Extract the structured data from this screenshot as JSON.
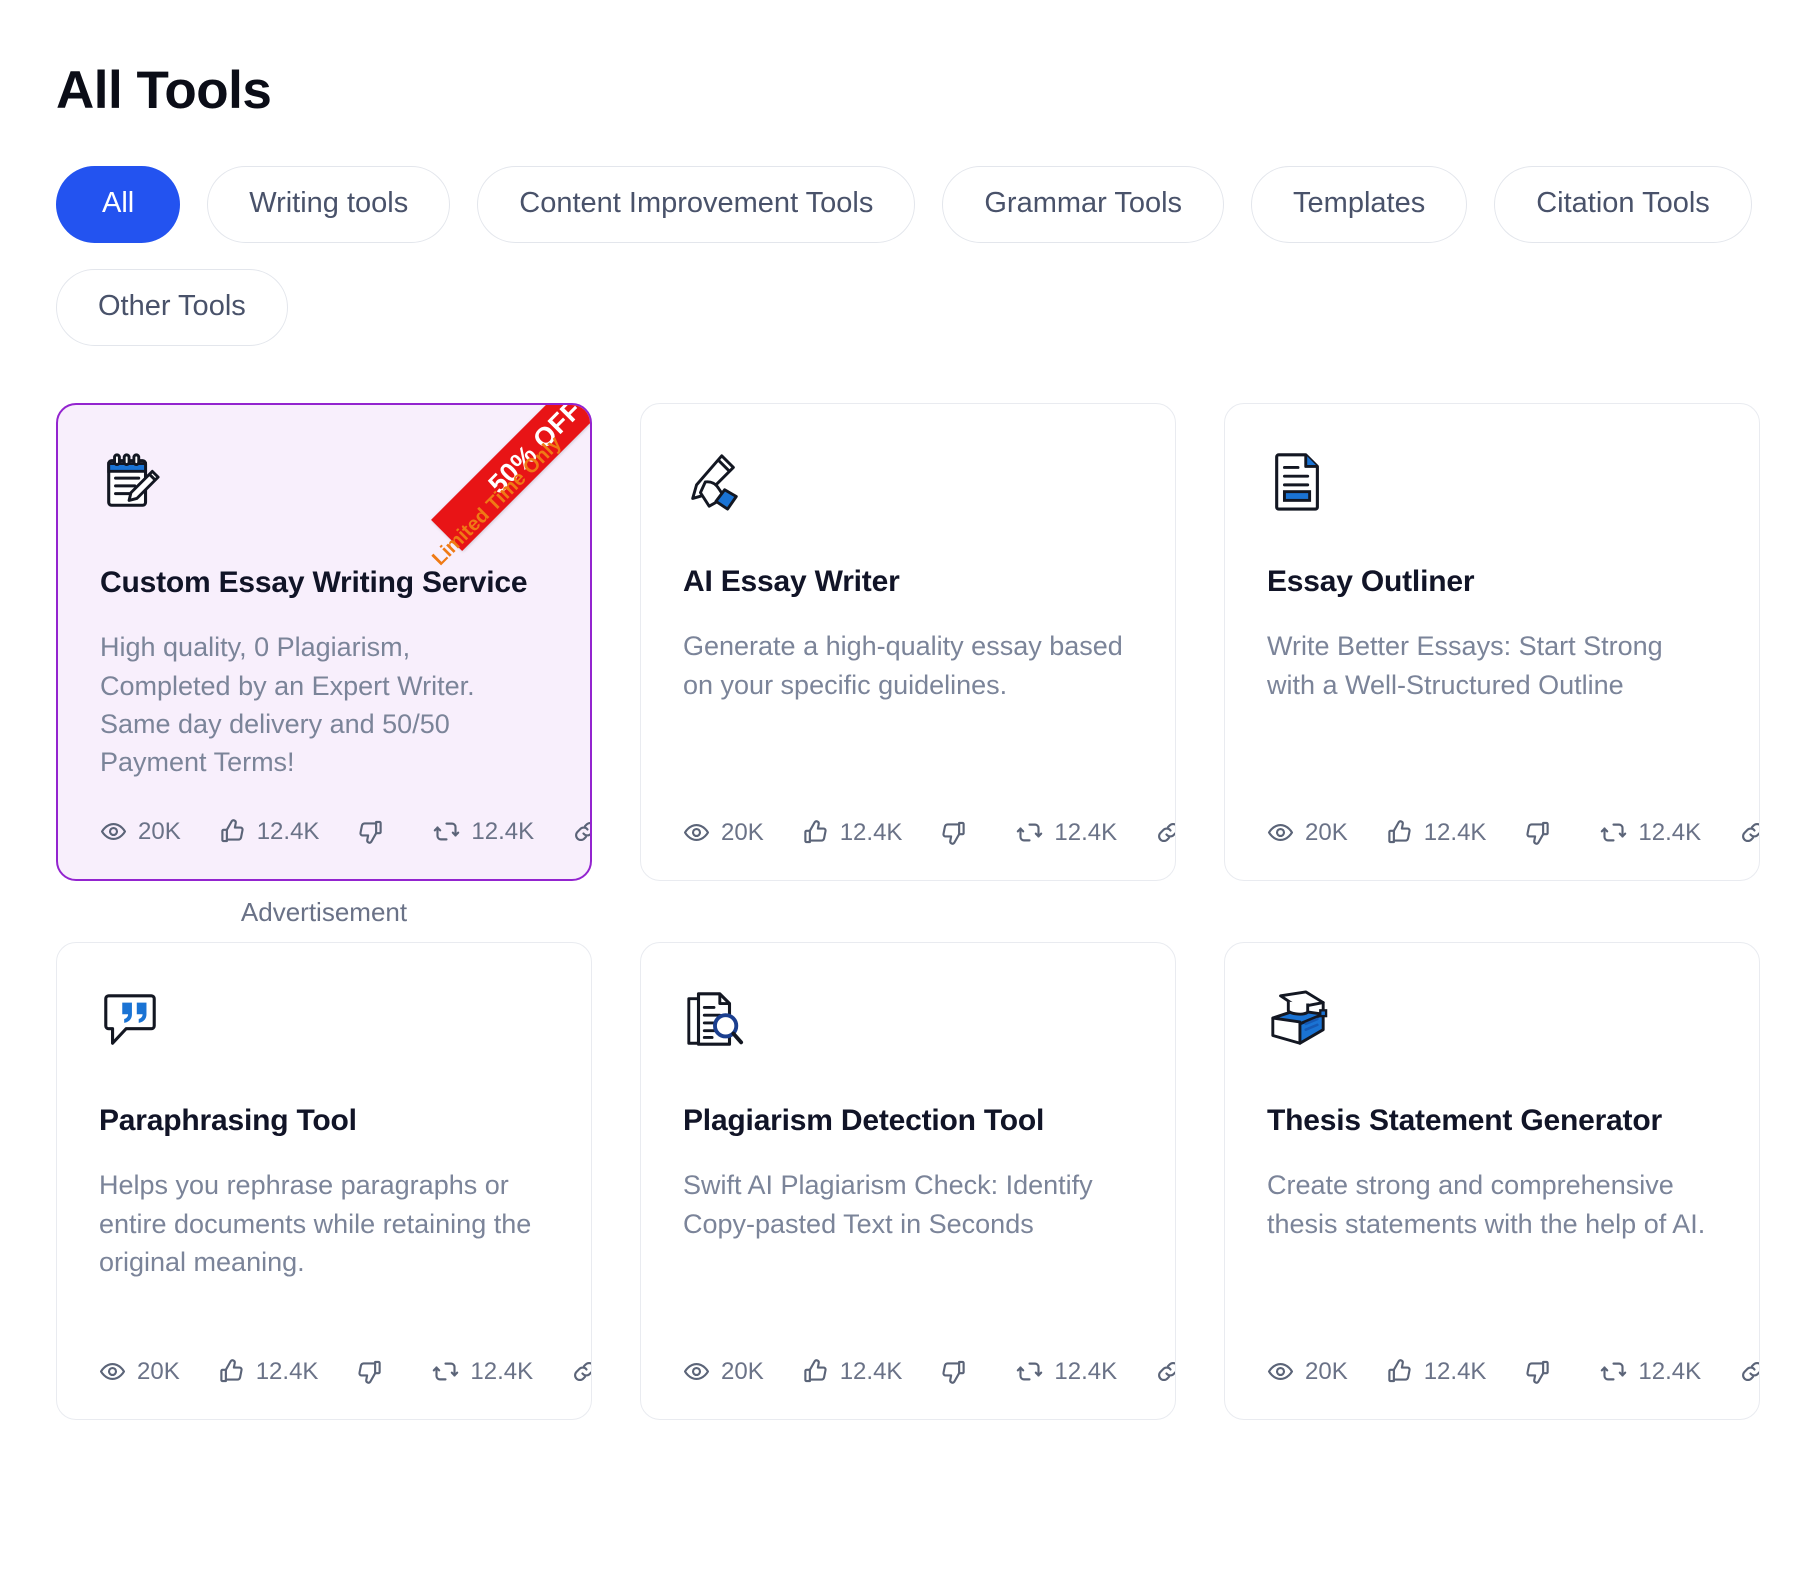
{
  "header": {
    "title": "All Tools"
  },
  "filters": [
    {
      "label": "All",
      "active": true
    },
    {
      "label": "Writing tools",
      "active": false
    },
    {
      "label": "Content Improvement Tools",
      "active": false
    },
    {
      "label": "Grammar Tools",
      "active": false
    },
    {
      "label": "Templates",
      "active": false
    },
    {
      "label": "Citation Tools",
      "active": false
    },
    {
      "label": "Other Tools",
      "active": false
    }
  ],
  "ribbon": {
    "main_label": "50% OFF",
    "sub_label": "Limited Time Only",
    "banner_color": "#e81416",
    "sub_color": "#ef7a15"
  },
  "ad_label": "Advertisement",
  "accent_colors": {
    "active_pill": "#2353f0",
    "promo_border": "#9324cf",
    "promo_background": "#f8effc",
    "icon_blue": "#1a73d4"
  },
  "stat_icons": [
    "eye-icon",
    "thumbs-up-icon",
    "thumbs-down-icon",
    "repost-icon",
    "link-icon"
  ],
  "cards": [
    {
      "icon": "notepad-pencil-icon",
      "title": "Custom Essay Writing Service",
      "description": "High quality, 0 Plagiarism, Completed by an Expert Writer. Same day delivery and 50/50 Payment Terms!",
      "promo": true,
      "stats": {
        "views": "20K",
        "likes": "12.4K",
        "dislikes": "",
        "reposts": "12.4K"
      }
    },
    {
      "icon": "hand-writing-pencil-icon",
      "title": "AI Essay Writer",
      "description": "Generate a high-quality essay based on your specific guidelines.",
      "promo": false,
      "stats": {
        "views": "20K",
        "likes": "12.4K",
        "dislikes": "",
        "reposts": "12.4K"
      }
    },
    {
      "icon": "document-outline-icon",
      "title": "Essay Outliner",
      "description": "Write Better Essays: Start Strong with a Well-Structured Outline",
      "promo": false,
      "stats": {
        "views": "20K",
        "likes": "12.4K",
        "dislikes": "",
        "reposts": "12.4K"
      }
    },
    {
      "icon": "quote-bubble-icon",
      "title": "Paraphrasing Tool",
      "description": "Helps you rephrase paragraphs or entire documents while retaining the original meaning.",
      "promo": false,
      "stats": {
        "views": "20K",
        "likes": "12.4K",
        "dislikes": "",
        "reposts": "12.4K"
      }
    },
    {
      "icon": "documents-magnifier-icon",
      "title": "Plagiarism Detection Tool",
      "description": "Swift AI Plagiarism Check: Identify Copy-pasted Text in Seconds",
      "promo": false,
      "stats": {
        "views": "20K",
        "likes": "12.4K",
        "dislikes": "",
        "reposts": "12.4K"
      }
    },
    {
      "icon": "graduation-book-icon",
      "title": "Thesis Statement Generator",
      "description": "Create strong and comprehensive thesis statements with the help of AI.",
      "promo": false,
      "stats": {
        "views": "20K",
        "likes": "12.4K",
        "dislikes": "",
        "reposts": "12.4K"
      }
    }
  ]
}
